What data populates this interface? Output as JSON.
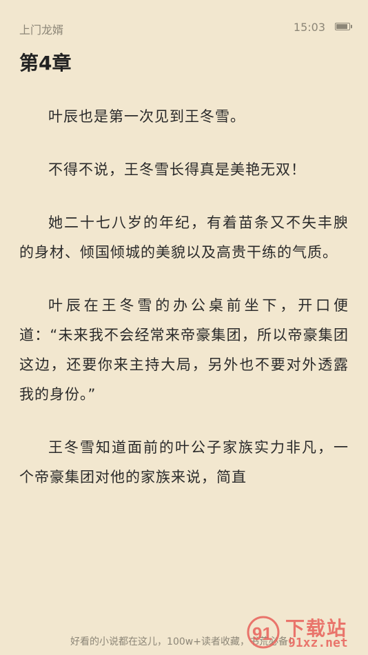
{
  "status_bar": {
    "book_name": "上门龙婿",
    "time": "15:03",
    "battery_icon": "battery-icon"
  },
  "chapter": {
    "title": "第4章",
    "paragraphs": [
      "叶辰也是第一次见到王冬雪。",
      "不得不说，王冬雪长得真是美艳无双！",
      "她二十七八岁的年纪，有着苗条又不失丰腴的身材、倾国倾城的美貌以及高贵干练的气质。",
      "叶辰在王冬雪的办公桌前坐下，开口便道：“未来我不会经常来帝豪集团，所以帝豪集团这边，还要你来主持大局，另外也不要对外透露我的身份。”",
      "王冬雪知道面前的叶公子家族实力非凡，一个帝豪集团对他的家族来说，简直"
    ]
  },
  "footer": {
    "text": "好看的小说都在这儿，100w+读者收藏，书荒必备！"
  },
  "watermark": {
    "logo_text": "91",
    "title": "下载站",
    "domain": "91xz.net",
    "color": "#e8615a"
  },
  "colors": {
    "background": "#f2e7cf",
    "text": "#2a2a2a",
    "muted": "#8c8677"
  }
}
